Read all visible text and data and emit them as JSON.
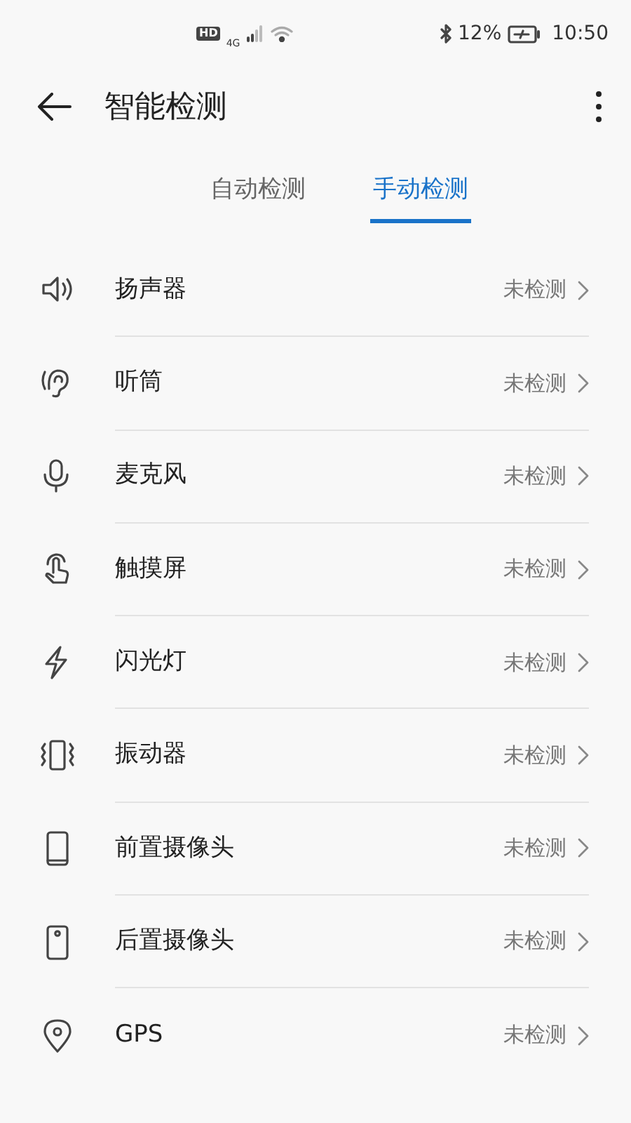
{
  "status_bar": {
    "hd": "HD",
    "network": "4G",
    "battery_percent": "12%",
    "time": "10:50"
  },
  "header": {
    "title": "智能检测"
  },
  "tabs": [
    {
      "label": "自动检测",
      "selected": false
    },
    {
      "label": "手动检测",
      "selected": true
    }
  ],
  "items": [
    {
      "kind": "speaker",
      "label": "扬声器",
      "status": "未检测"
    },
    {
      "kind": "earpiece",
      "label": "听筒",
      "status": "未检测"
    },
    {
      "kind": "microphone",
      "label": "麦克风",
      "status": "未检测"
    },
    {
      "kind": "touch",
      "label": "触摸屏",
      "status": "未检测"
    },
    {
      "kind": "flash",
      "label": "闪光灯",
      "status": "未检测"
    },
    {
      "kind": "vibration",
      "label": "振动器",
      "status": "未检测"
    },
    {
      "kind": "front-camera",
      "label": "前置摄像头",
      "status": "未检测"
    },
    {
      "kind": "rear-camera",
      "label": "后置摄像头",
      "status": "未检测"
    },
    {
      "kind": "gps",
      "label": "GPS",
      "status": "未检测"
    }
  ]
}
